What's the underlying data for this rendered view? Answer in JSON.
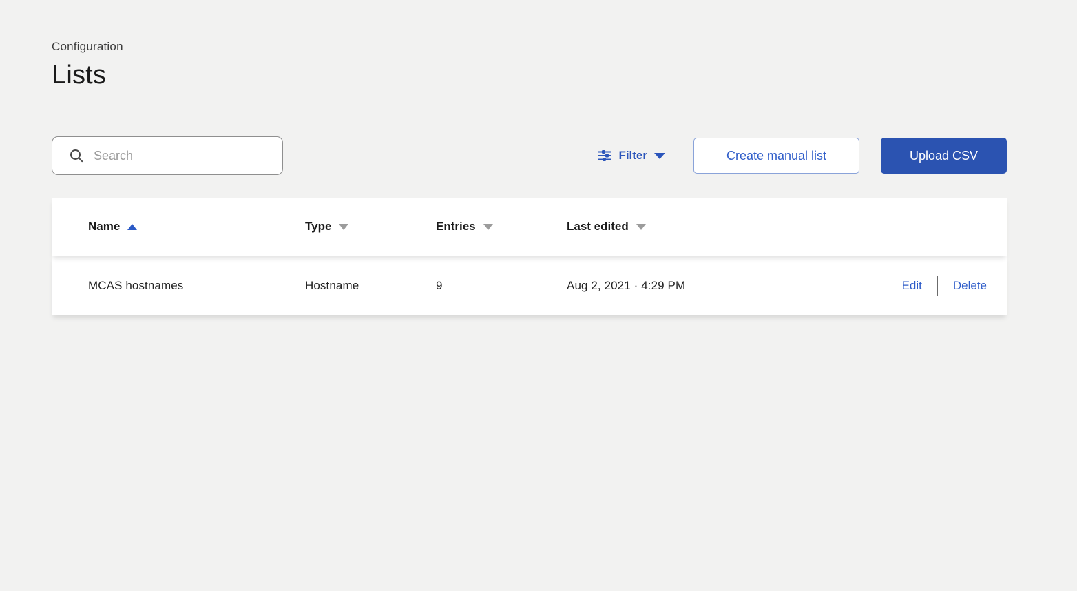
{
  "page": {
    "breadcrumb": "Configuration",
    "title": "Lists"
  },
  "toolbar": {
    "search_placeholder": "Search",
    "filter_label": "Filter",
    "create_manual_list_label": "Create manual list",
    "upload_csv_label": "Upload CSV"
  },
  "table": {
    "columns": [
      {
        "label": "Name",
        "sort": "ascending-active"
      },
      {
        "label": "Type",
        "sort": "descending-inactive"
      },
      {
        "label": "Entries",
        "sort": "descending-inactive"
      },
      {
        "label": "Last edited",
        "sort": "descending-inactive"
      }
    ],
    "rows": [
      {
        "name": "MCAS hostnames",
        "type": "Hostname",
        "entries": "9",
        "last_edited": "Aug 2, 2021 · 4:29 PM",
        "edit_label": "Edit",
        "delete_label": "Delete"
      }
    ]
  },
  "icons": {
    "search": "search-icon",
    "filter": "sliders-icon",
    "filter_caret": "chevron-down-icon",
    "name_sort": "triangle-up-icon",
    "other_sort": "triangle-down-icon"
  },
  "colors": {
    "background": "#f2f2f1",
    "accent_link_blue": "#2f5dc9",
    "primary_button_blue": "#2b53b1",
    "filter_blue": "#2b55bb",
    "active_sort_blue": "#2b5ac6",
    "inactive_sort_gray": "#9c9c9c"
  }
}
